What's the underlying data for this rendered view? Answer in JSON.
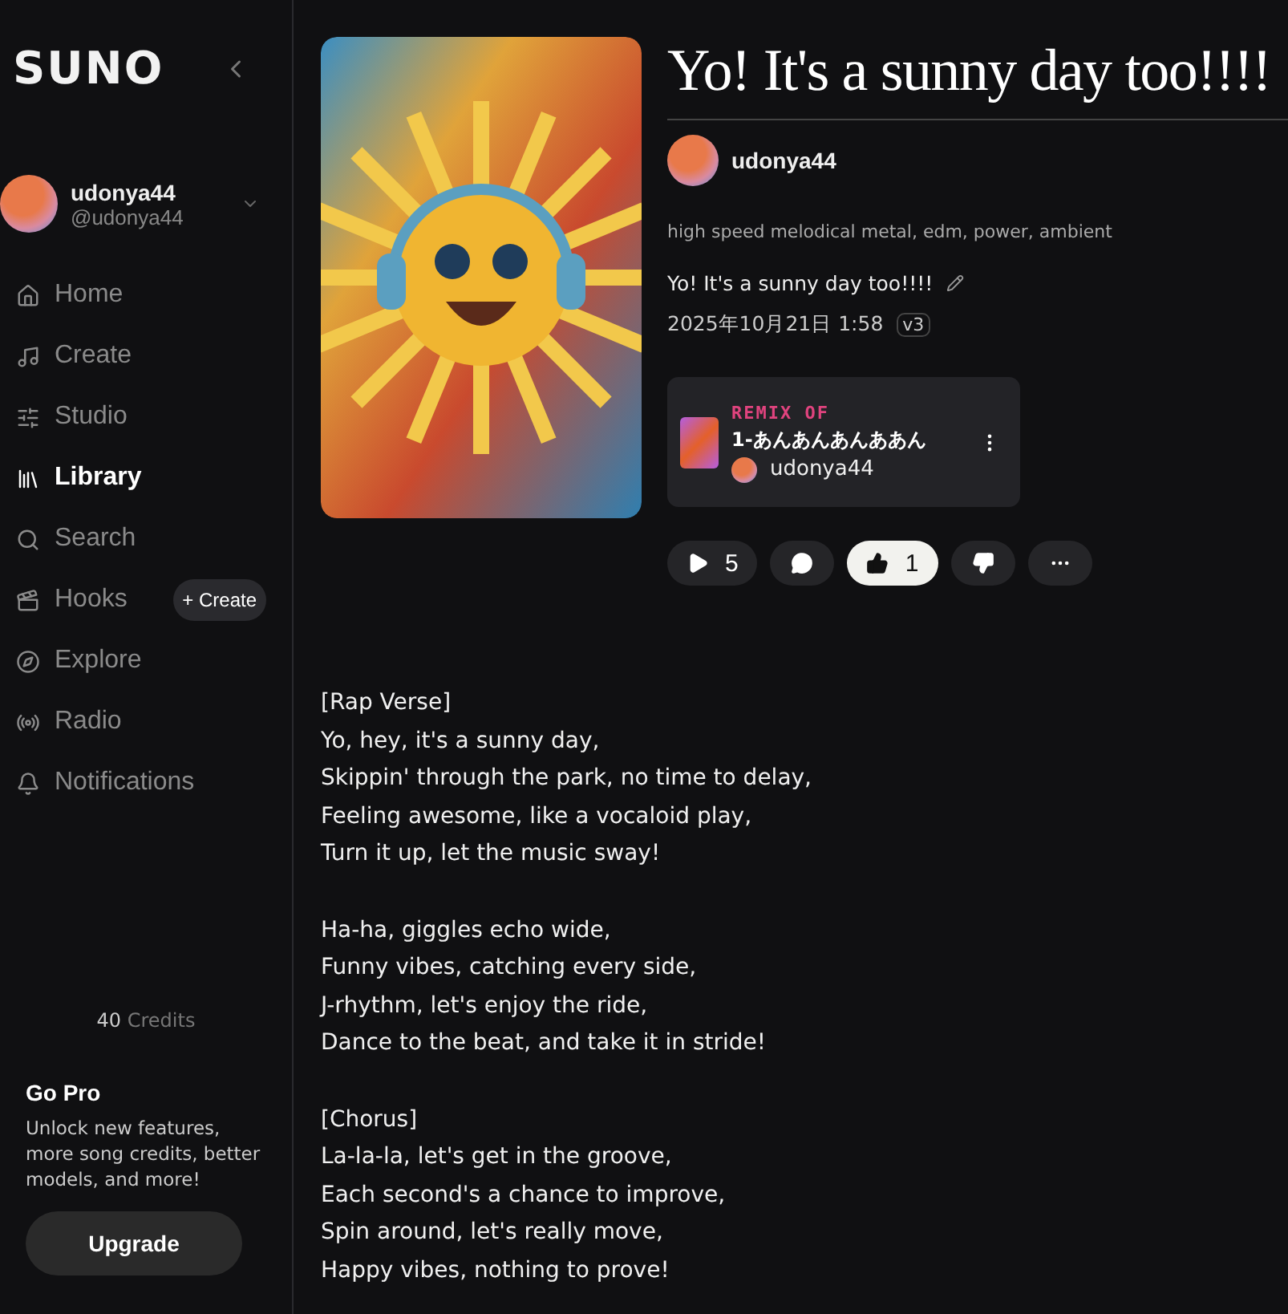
{
  "logo": "SUNO",
  "user": {
    "name": "udonya44",
    "handle": "@udonya44"
  },
  "nav": [
    {
      "label": "Home",
      "kind": "home",
      "selected": false
    },
    {
      "label": "Create",
      "kind": "create",
      "selected": false
    },
    {
      "label": "Studio",
      "kind": "studio",
      "selected": false
    },
    {
      "label": "Library",
      "kind": "library",
      "selected": true
    },
    {
      "label": "Search",
      "kind": "search",
      "selected": false
    },
    {
      "label": "Hooks",
      "kind": "hooks",
      "selected": false,
      "action": "+ Create"
    },
    {
      "label": "Explore",
      "kind": "explore",
      "selected": false
    },
    {
      "label": "Radio",
      "kind": "radio",
      "selected": false
    },
    {
      "label": "Notifications",
      "kind": "bell",
      "selected": false
    }
  ],
  "credits": {
    "count": "40",
    "label": "Credits"
  },
  "promo": {
    "title": "Go Pro",
    "text": "Unlock new features, more song credits, better models, and more!",
    "button": "Upgrade"
  },
  "song": {
    "title": "Yo! It's a sunny day too!!!!",
    "artist": "udonya44",
    "styles": "high speed melodical metal, edm, power, ambient",
    "caption": "Yo! It's a sunny day too!!!!",
    "date": "2025年10月21日 1:58",
    "version": "v3",
    "remix": {
      "label": "REMIX OF",
      "title": "1-あんあんあんああん",
      "artist": "udonya44"
    },
    "actions": [
      {
        "kind": "play",
        "count": "5",
        "selected": false
      },
      {
        "kind": "comment",
        "selected": false
      },
      {
        "kind": "like",
        "count": "1",
        "selected": true
      },
      {
        "kind": "dislike",
        "selected": false
      },
      {
        "kind": "more",
        "selected": false
      }
    ]
  },
  "lyrics": [
    [
      "[Rap Verse]",
      "Yo, hey, it's a sunny day,",
      "Skippin' through the park, no time to delay,",
      "Feeling awesome, like a vocaloid play,",
      "Turn it up, let the music sway!"
    ],
    [
      "Ha-ha, giggles echo wide,",
      "Funny vibes, catching every side,",
      "J-rhythm, let's enjoy the ride,",
      "Dance to the beat, and take it in stride!"
    ],
    [
      "[Chorus]",
      "La-la-la, let's get in the groove,",
      "Each second's a chance to improve,",
      "Spin around, let's really move,",
      "Happy vibes, nothing to prove!"
    ]
  ]
}
